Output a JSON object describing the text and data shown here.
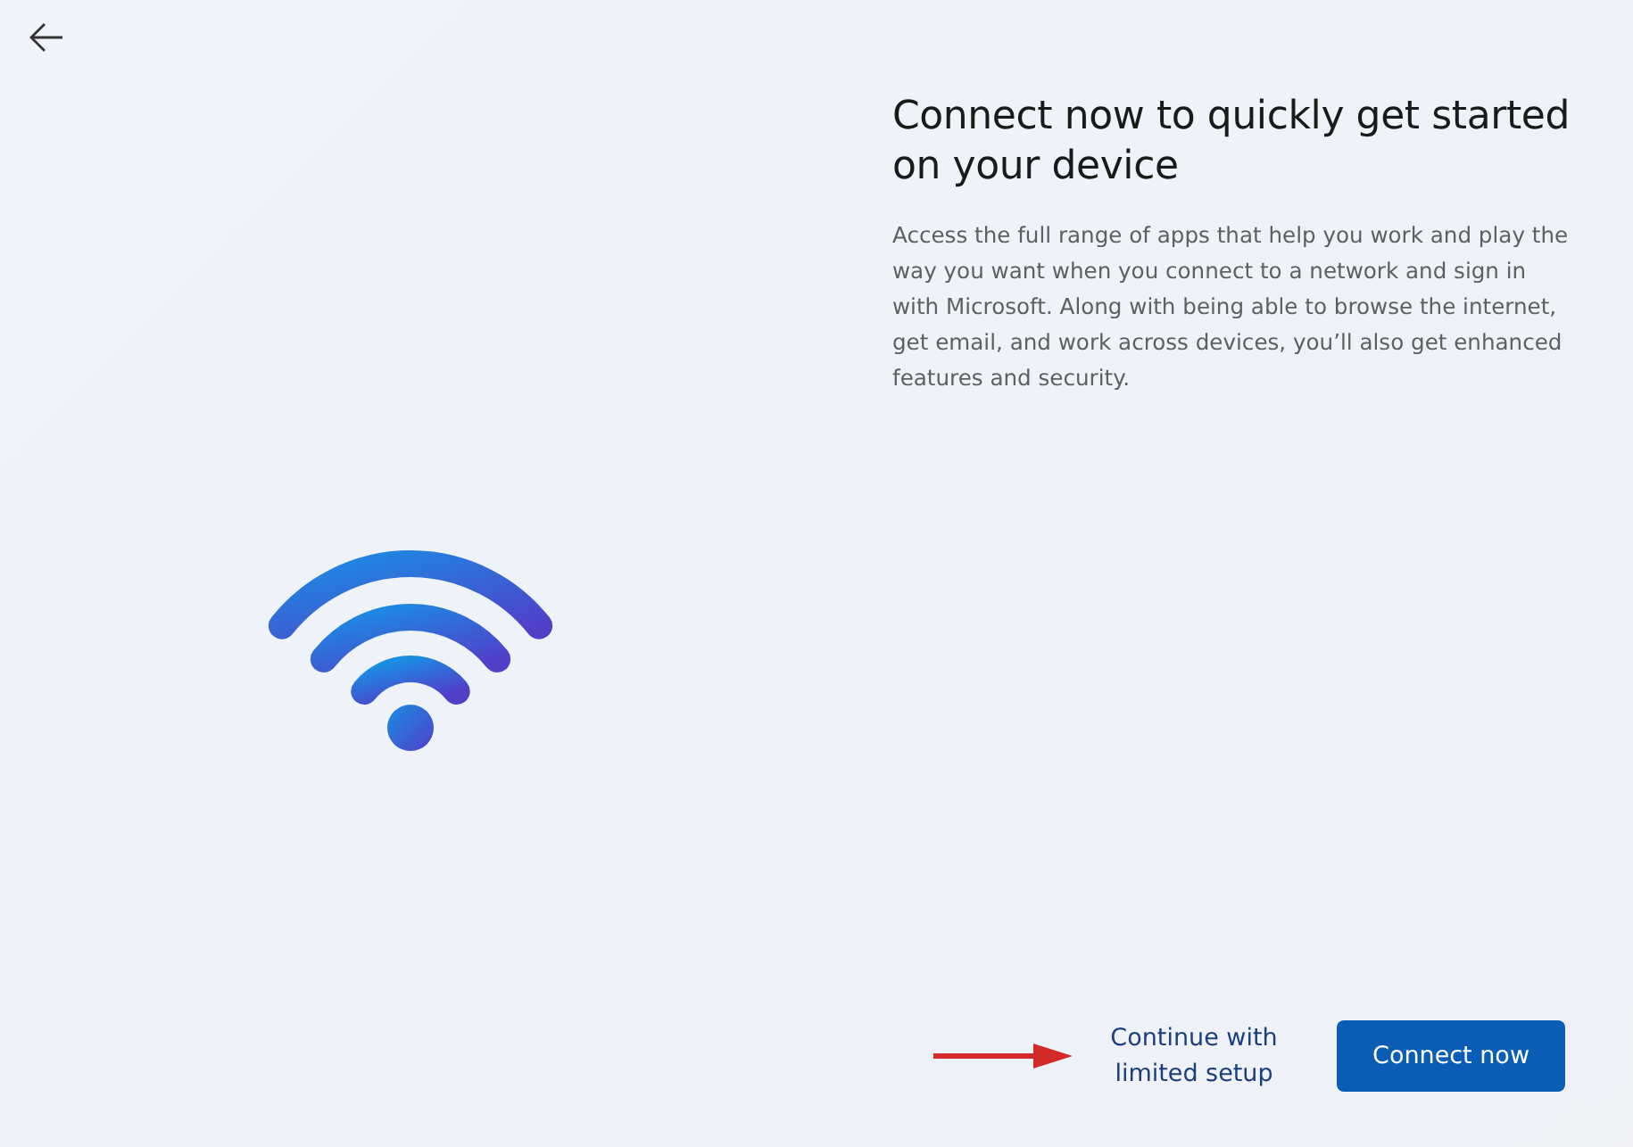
{
  "title": "Connect now to quickly get started on your device",
  "description": "Access the full range of apps that help you work and play the way you want when you connect to a network and sign in with Microsoft. Along with being able to browse the internet, get email, and work across devices, you’ll also get enhanced features and security.",
  "footer": {
    "link": "Continue with limited setup",
    "button": "Connect now"
  }
}
